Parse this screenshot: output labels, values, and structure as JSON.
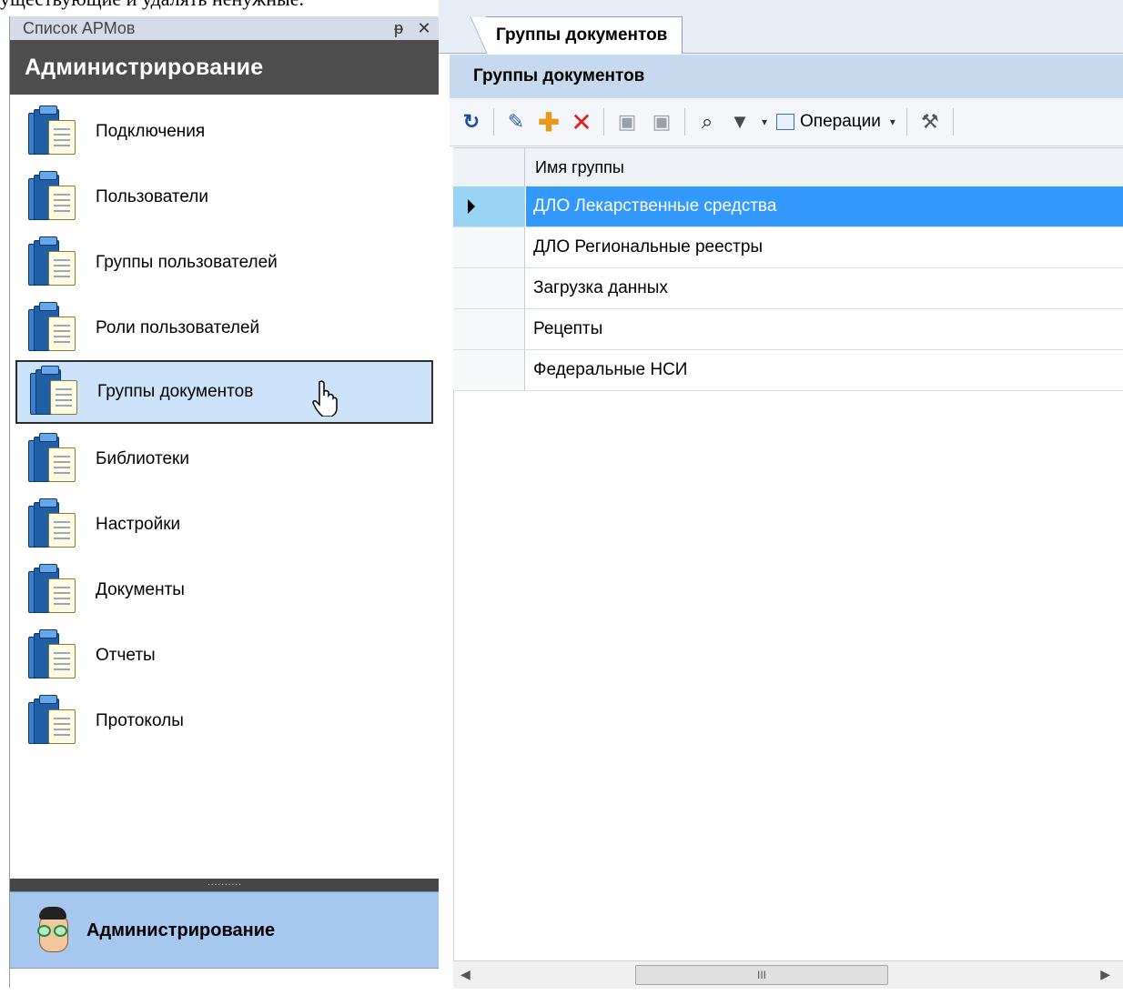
{
  "doc_text": "уществующие и удалять ненужные.",
  "left_panel": {
    "header_title": "Список АРМов",
    "pin_icon": "pin-icon",
    "close_icon": "close-icon",
    "section_title": "Администрирование",
    "items": [
      {
        "label": "Подключения"
      },
      {
        "label": "Пользователи"
      },
      {
        "label": "Группы пользователей"
      },
      {
        "label": "Роли пользователей"
      },
      {
        "label": "Группы документов",
        "selected": true
      },
      {
        "label": "Библиотеки"
      },
      {
        "label": "Настройки"
      },
      {
        "label": "Документы"
      },
      {
        "label": "Отчеты"
      },
      {
        "label": "Протоколы"
      }
    ],
    "splitter_grip": "..........",
    "bottom_item": {
      "label": "Администрирование",
      "icon": "admin-avatar-icon"
    }
  },
  "right_panel": {
    "tab_label": "Группы документов",
    "panel_title": "Группы документов",
    "toolbar": {
      "operations_label": "Операции",
      "buttons": [
        "refresh-icon",
        "edit-icon",
        "add-icon",
        "delete-icon",
        "save-icon",
        "save-all-icon",
        "find-icon",
        "filter-icon",
        "operations-icon",
        "tools-icon"
      ]
    },
    "grid": {
      "column_header": "Имя группы",
      "rows": [
        "ДЛО Лекарственные средства",
        "ДЛО Региональные реестры",
        "Загрузка данных",
        "Рецепты",
        "Федеральные НСИ"
      ],
      "selected_index": 0
    },
    "scrollbar_thumb": "III"
  },
  "colors": {
    "selection_blue": "#3399ff",
    "nav_selected_bg": "#cde3f9",
    "section_dark": "#4d4d4d",
    "bottom_item_bg": "#a7c8ee"
  }
}
